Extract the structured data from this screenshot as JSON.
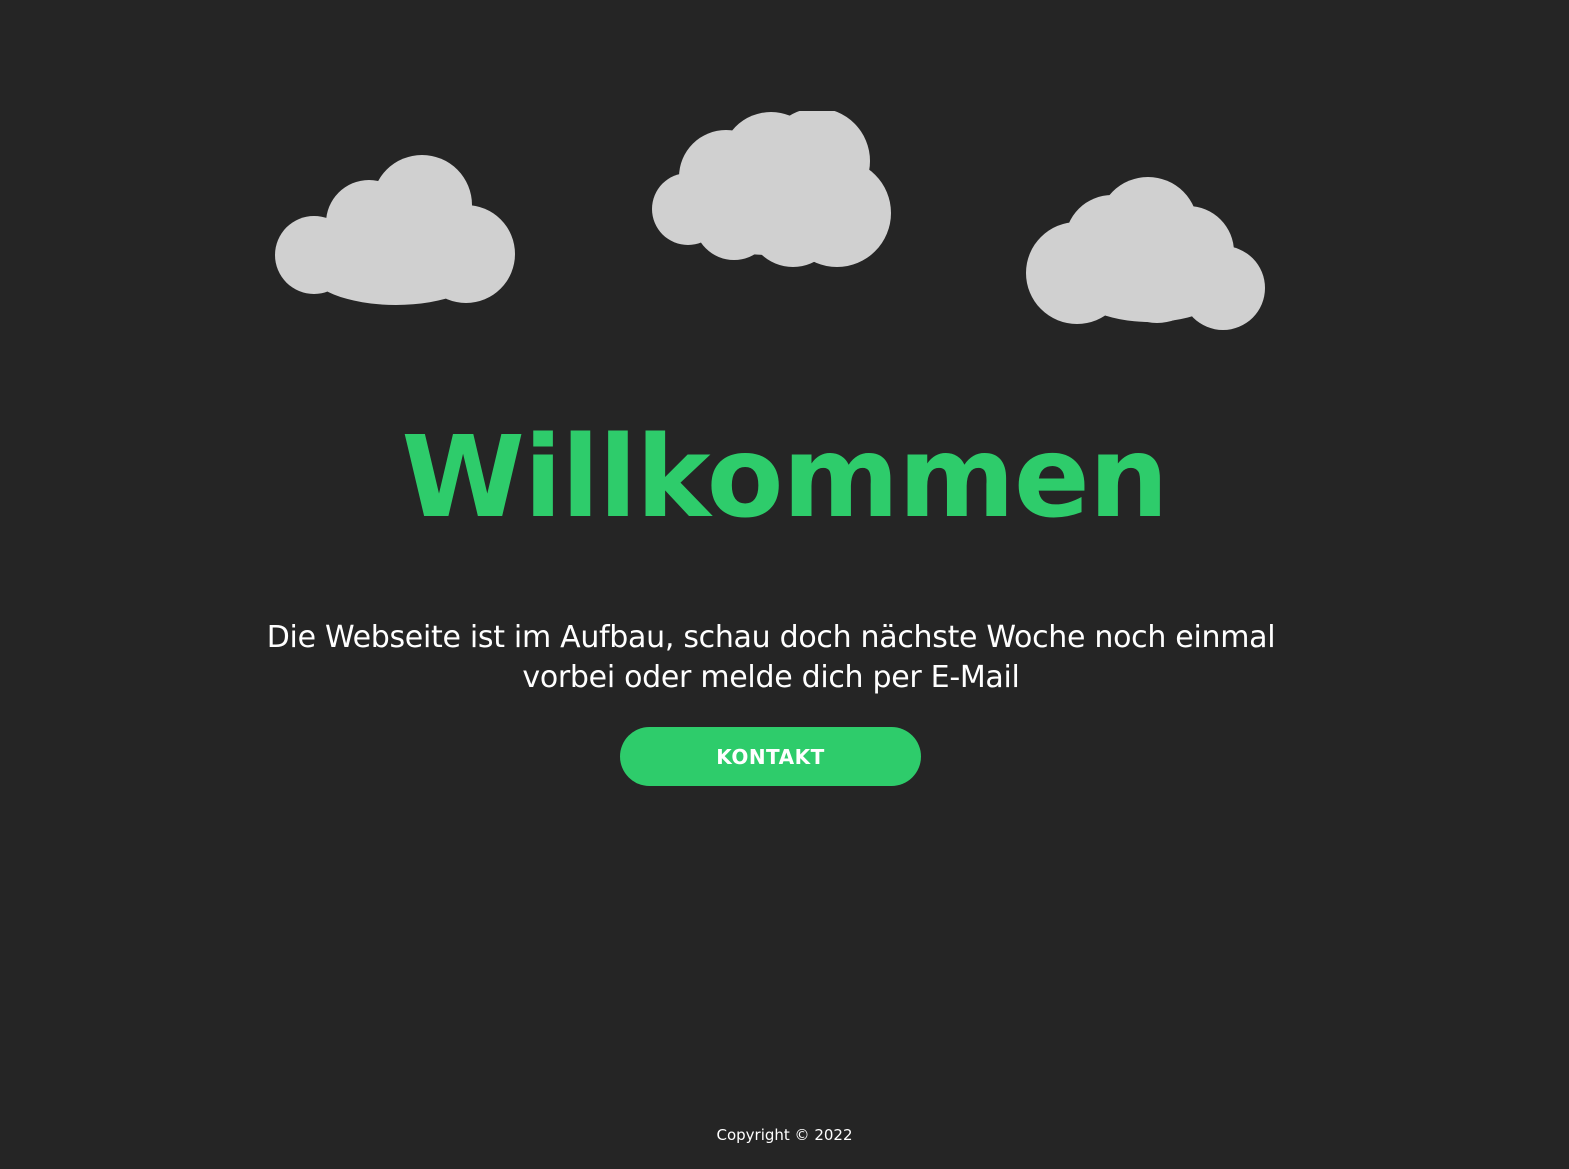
{
  "colors": {
    "background": "#252525",
    "accent": "#2ecc6b",
    "cloud": "#d0d0d0",
    "text": "#ffffff"
  },
  "hero": {
    "title": "Willkommen",
    "message": "Die Webseite ist im Aufbau, schau doch nächste Woche noch einmal vorbei oder melde dich per E-Mail",
    "button_label": "KONTAKT"
  },
  "decorations": {
    "icons": [
      "cloud-icon",
      "cloud-icon",
      "cloud-icon"
    ]
  },
  "footer": {
    "copyright": "Copyright © 2022"
  }
}
